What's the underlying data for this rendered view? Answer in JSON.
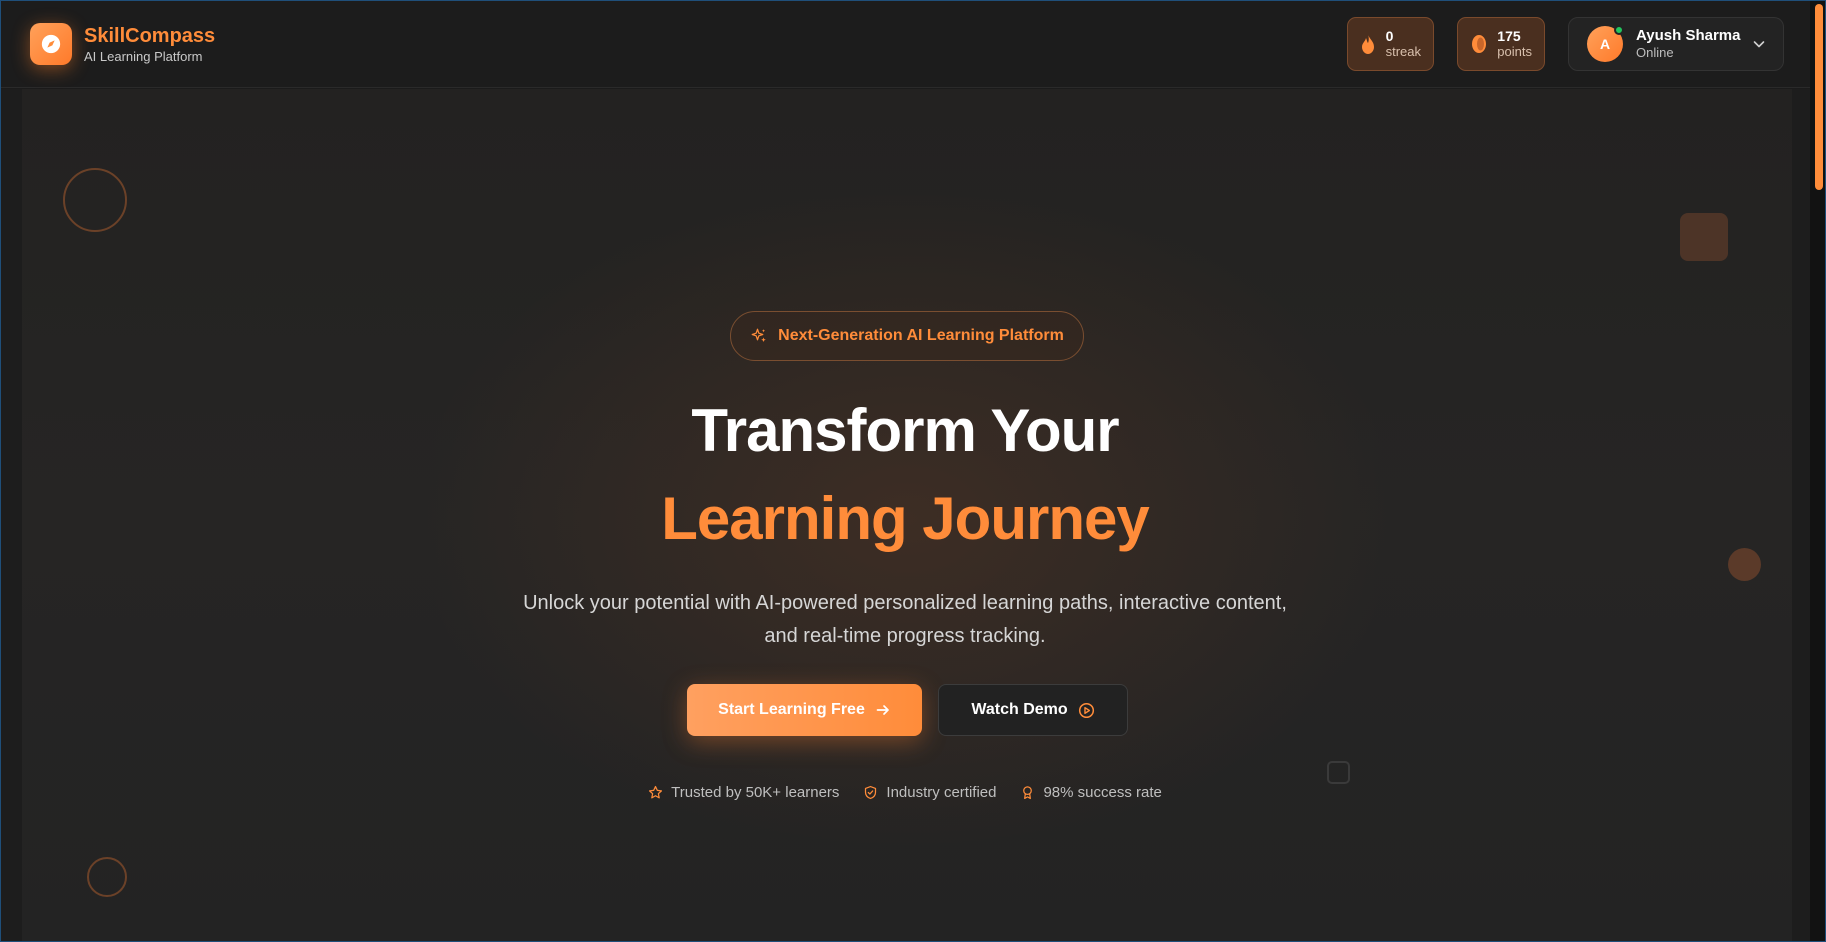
{
  "brand": {
    "name": "SkillCompass",
    "tagline": "AI Learning Platform"
  },
  "stats": {
    "streak": {
      "value": "0",
      "label": "streak"
    },
    "points": {
      "value": "175",
      "label": "points"
    }
  },
  "user": {
    "initial": "A",
    "name": "Ayush Sharma",
    "status": "Online"
  },
  "hero": {
    "badge": "Next-Generation AI Learning Platform",
    "title_line1": "Transform Your",
    "title_line2": "Learning Journey",
    "subtitle_line1": "Unlock your potential with AI-powered personalized learning paths, interactive content,",
    "subtitle_line2": "and real-time progress tracking.",
    "primary_button": "Start Learning Free",
    "secondary_button": "Watch Demo",
    "trust": [
      "Trusted by 50K+ learners",
      "Industry certified",
      "98% success rate"
    ]
  },
  "colors": {
    "accent": "#ff8c3a",
    "background": "#1b1b1b",
    "online": "#22c55e"
  },
  "icons": [
    "compass-icon",
    "flame-icon",
    "coin-icon",
    "chevron-down-icon",
    "sparkles-icon",
    "arrow-right-icon",
    "play-circle-icon",
    "star-icon",
    "shield-icon",
    "award-icon"
  ]
}
